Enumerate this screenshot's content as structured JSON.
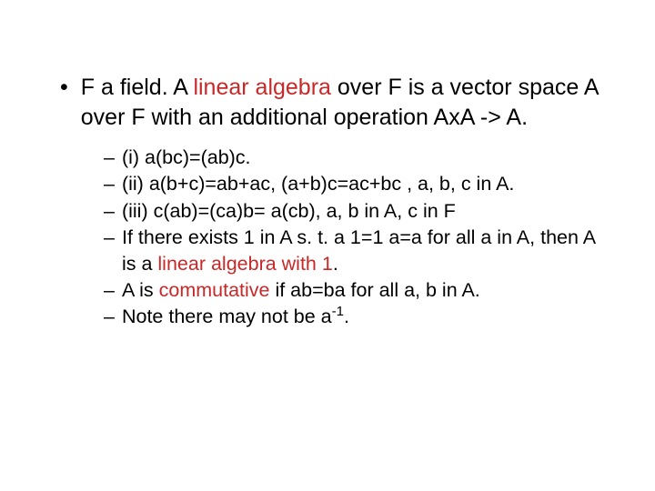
{
  "main": {
    "bullet": "•",
    "part1": "F a field. A ",
    "red1": "linear algebra",
    "part2": " over F is a vector space  A  over F with an additional operation A",
    "x": "x",
    "part3": "A -> A."
  },
  "subs": {
    "dash": "–",
    "i": "(i) a(bc)=(ab)c.",
    "ii": "(ii) a(b+c)=ab+ac, (a+b)c=ac+bc , a, b, c in A.",
    "iii": "(iii) c(ab)=(ca)b= a(cb), a, b in A, c in F",
    "four_a": "If there exists 1 in A s. t. a 1=1 a=a for all a in A, then A is a ",
    "four_red": "linear algebra with 1",
    "four_b": ".",
    "five_a": "A is ",
    "five_red": "commutative",
    "five_b": " if ab=ba for all a, b in A.",
    "six_a": "Note there may not be a",
    "six_sup": "-1",
    "six_b": "."
  }
}
